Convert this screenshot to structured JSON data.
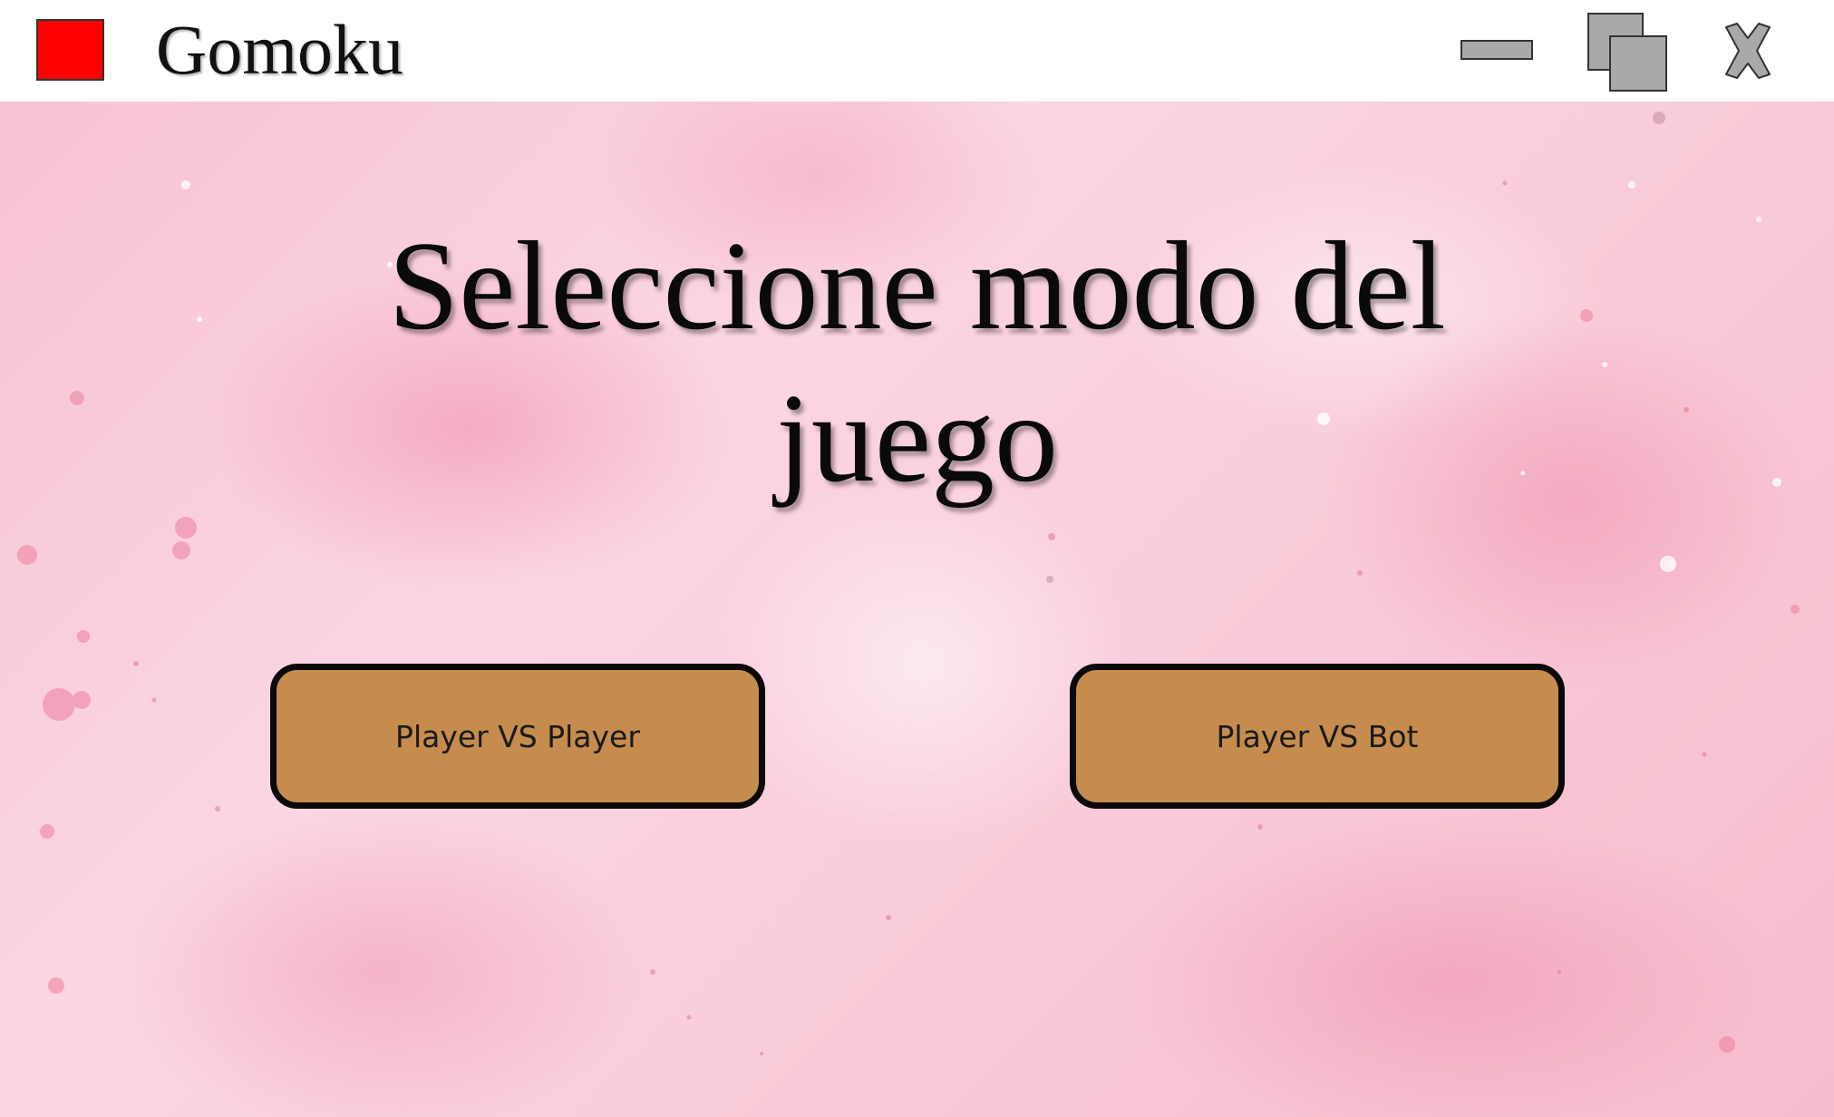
{
  "window": {
    "title": "Gomoku",
    "app_icon_color": "#ff0000",
    "controls": {
      "minimize_icon": "minimize-icon",
      "maximize_icon": "maximize-icon",
      "close_icon": "close-icon"
    }
  },
  "main": {
    "heading_line1": "Seleccione modo del",
    "heading_line2": "juego",
    "background_color": "#f8c9d6",
    "buttons": [
      {
        "label": "Player VS Player",
        "color": "#c68c4d"
      },
      {
        "label": "Player VS Bot",
        "color": "#c68c4d"
      }
    ]
  }
}
